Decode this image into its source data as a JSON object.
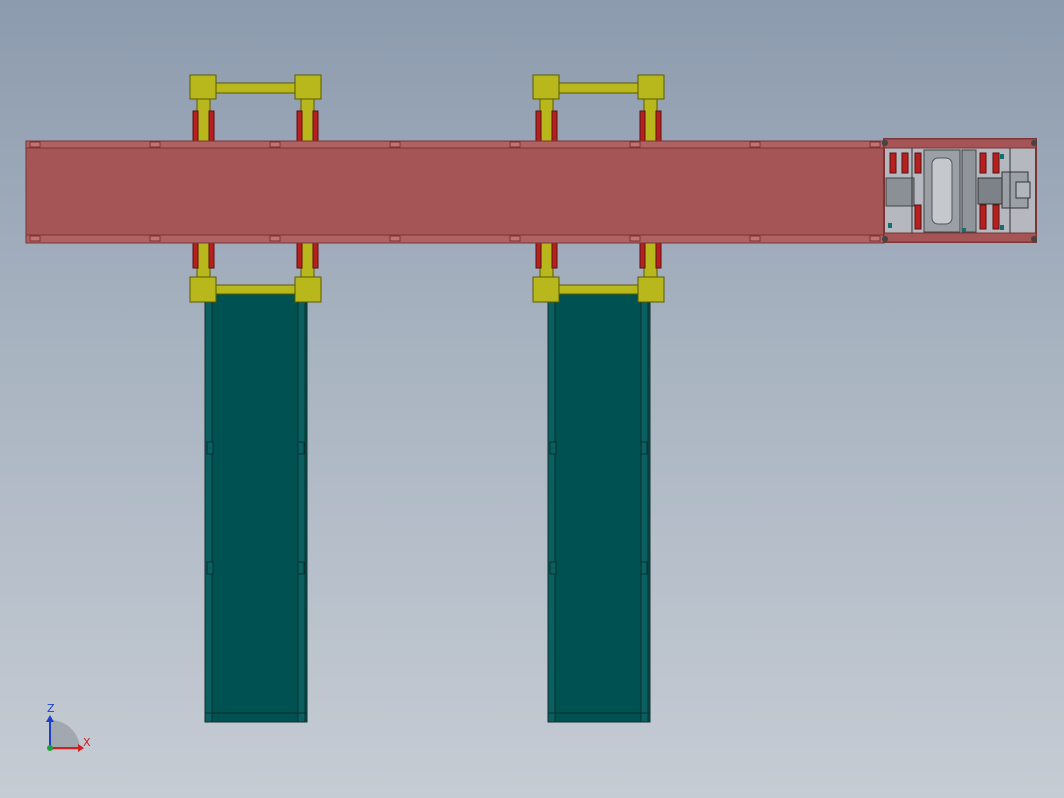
{
  "view": {
    "background_top": "#8c9bae",
    "background_bottom": "#c6ccd4"
  },
  "colors": {
    "main_conveyor": "#a55555",
    "main_conveyor_edge": "#7a3434",
    "cross_conveyor": "#005252",
    "cross_conveyor_edge": "#0f2f2f",
    "lift_frame": "#b8b81c",
    "lift_frame_edge": "#5a5a00",
    "lift_cylinder": "#b82020",
    "drive_unit_frame": "#a55555",
    "drive_unit_gray": "#9aa0a6"
  },
  "triad": {
    "z_label": "Z",
    "x_label": "X",
    "z_color": "#1a3fcf",
    "x_color": "#d02020",
    "y_color": "#1fa03a"
  }
}
